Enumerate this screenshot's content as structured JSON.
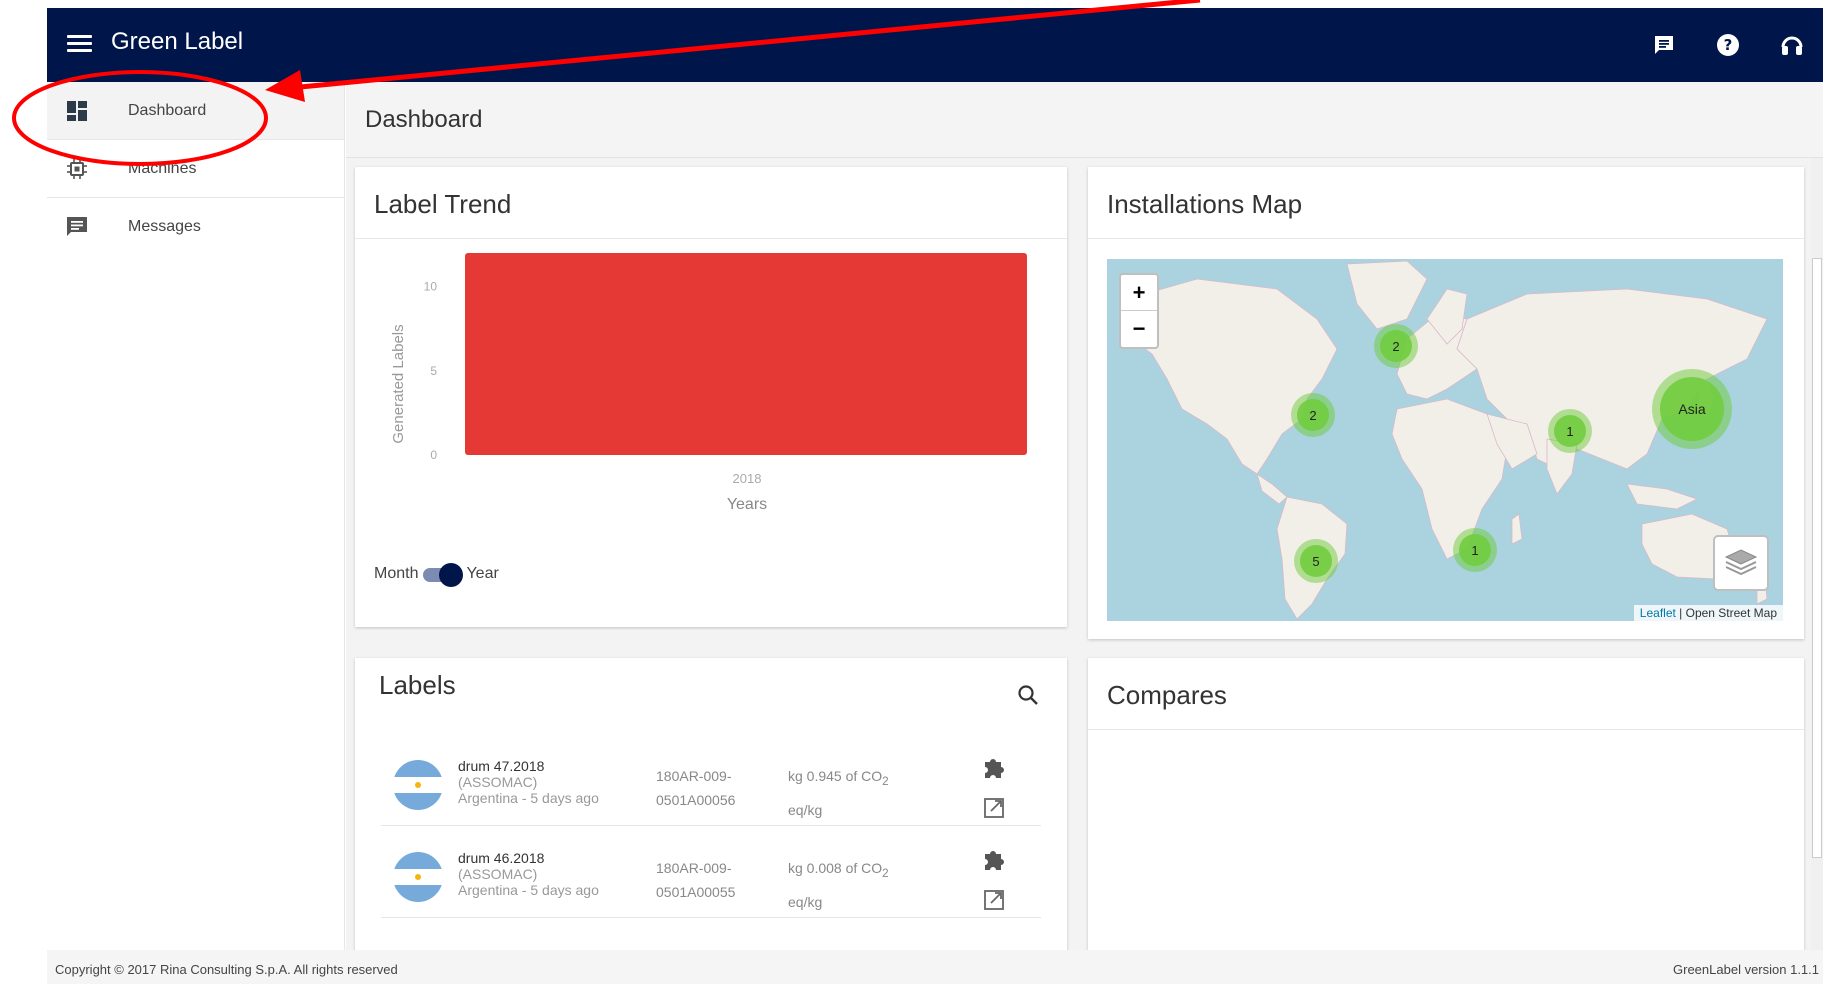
{
  "app": {
    "title": "Green Label"
  },
  "header_icons": [
    "messages-icon",
    "help-icon",
    "support-headset-icon"
  ],
  "sidebar": {
    "items": [
      {
        "label": "Dashboard",
        "icon": "dashboard-icon",
        "active": true
      },
      {
        "label": "Machines",
        "icon": "chip-icon",
        "active": false
      },
      {
        "label": "Messages",
        "icon": "message-icon",
        "active": false
      }
    ]
  },
  "page": {
    "title": "Dashboard"
  },
  "label_trend": {
    "title": "Label Trend",
    "toggle": {
      "left": "Month",
      "right": "Year",
      "selected": "Year"
    }
  },
  "chart_data": {
    "type": "bar",
    "title": "",
    "categories": [
      "2018"
    ],
    "values": [
      12
    ],
    "xlabel": "Years",
    "ylabel": "Generated Labels",
    "yticks": [
      0,
      5,
      10
    ],
    "ylim": [
      0,
      12
    ],
    "grid": false,
    "color": "#e53935"
  },
  "map": {
    "title": "Installations Map",
    "zoom_in": "+",
    "zoom_out": "−",
    "attribution_link": "Leaflet",
    "attribution_text": " | Open Street Map",
    "clusters": [
      {
        "label": "2",
        "region": "Northern Europe"
      },
      {
        "label": "2",
        "region": "North America"
      },
      {
        "label": "1",
        "region": "South Asia"
      },
      {
        "label": "Asia",
        "region": "East Asia"
      },
      {
        "label": "5",
        "region": "South America"
      },
      {
        "label": "1",
        "region": "Southern Africa"
      }
    ]
  },
  "labels": {
    "title": "Labels",
    "rows": [
      {
        "name": "drum 47.2018",
        "owner": "(ASSOMAC)",
        "location": "Argentina - 5 days ago",
        "code1": "180AR-009-",
        "code2": "0501A00056",
        "value": "kg 0.945 of CO",
        "unit_sub": "2",
        "unit": "eq/kg"
      },
      {
        "name": "drum 46.2018",
        "owner": "(ASSOMAC)",
        "location": "Argentina - 5 days ago",
        "code1": "180AR-009-",
        "code2": "0501A00055",
        "value": "kg 0.008 of CO",
        "unit_sub": "2",
        "unit": "eq/kg"
      }
    ]
  },
  "compares": {
    "title": "Compares"
  },
  "footer": {
    "copyright": "Copyright © 2017 Rina Consulting S.p.A. All rights reserved",
    "version": "GreenLabel version 1.1.1"
  },
  "colors": {
    "header": "#00164b",
    "bar": "#e53935",
    "cluster": "#6ecc39",
    "annotation": "#ff0000"
  }
}
